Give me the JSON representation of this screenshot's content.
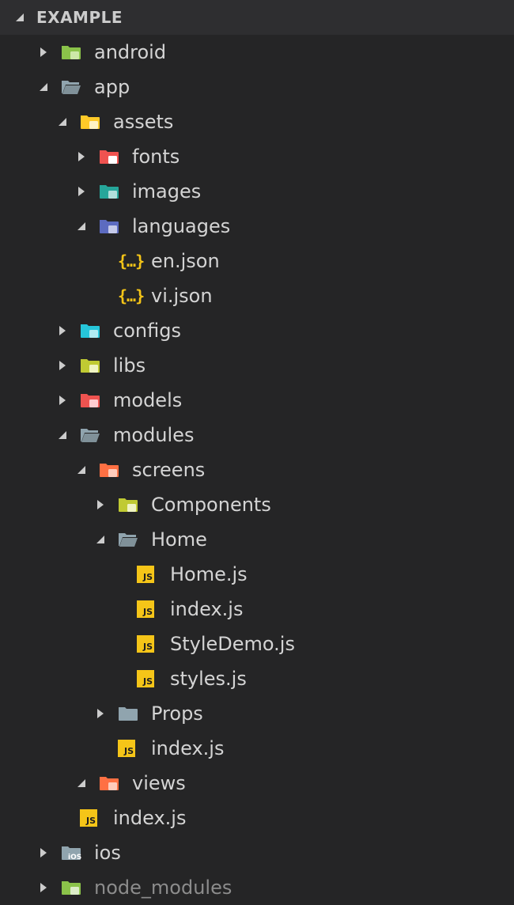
{
  "explorer": {
    "section_title": "EXAMPLE",
    "colors": {
      "background": "#252526",
      "header_background": "#2e2e30",
      "text": "#d4d4d4",
      "dim_text": "#8c8c8c",
      "js_badge": "#f5c518"
    }
  },
  "tree": [
    {
      "name": "android",
      "depth": 0,
      "kind": "folder",
      "expanded": false,
      "icon": "android-folder-icon",
      "color": "#8bc34a"
    },
    {
      "name": "app",
      "depth": 0,
      "kind": "folder",
      "expanded": true,
      "icon": "open-folder-icon",
      "color": "#90a4ae"
    },
    {
      "name": "assets",
      "depth": 1,
      "kind": "folder",
      "expanded": true,
      "icon": "assets-folder-icon",
      "color": "#ffca28"
    },
    {
      "name": "fonts",
      "depth": 2,
      "kind": "folder",
      "expanded": false,
      "icon": "fonts-folder-icon",
      "color": "#ef5350"
    },
    {
      "name": "images",
      "depth": 2,
      "kind": "folder",
      "expanded": false,
      "icon": "images-folder-icon",
      "color": "#26a69a"
    },
    {
      "name": "languages",
      "depth": 2,
      "kind": "folder",
      "expanded": true,
      "icon": "languages-folder-icon",
      "color": "#5c6bc0"
    },
    {
      "name": "en.json",
      "depth": 3,
      "kind": "json",
      "icon": "json-file-icon"
    },
    {
      "name": "vi.json",
      "depth": 3,
      "kind": "json",
      "icon": "json-file-icon"
    },
    {
      "name": "configs",
      "depth": 1,
      "kind": "folder",
      "expanded": false,
      "icon": "config-folder-icon",
      "color": "#26c6da"
    },
    {
      "name": "libs",
      "depth": 1,
      "kind": "folder",
      "expanded": false,
      "icon": "libs-folder-icon",
      "color": "#c0ca33"
    },
    {
      "name": "models",
      "depth": 1,
      "kind": "folder",
      "expanded": false,
      "icon": "models-folder-icon",
      "color": "#ef5350"
    },
    {
      "name": "modules",
      "depth": 1,
      "kind": "folder",
      "expanded": true,
      "icon": "open-folder-icon",
      "color": "#90a4ae"
    },
    {
      "name": "screens",
      "depth": 2,
      "kind": "folder",
      "expanded": true,
      "icon": "screens-folder-icon",
      "color": "#ff7043"
    },
    {
      "name": "Components",
      "depth": 3,
      "kind": "folder",
      "expanded": false,
      "icon": "components-folder-icon",
      "color": "#c0ca33"
    },
    {
      "name": "Home",
      "depth": 3,
      "kind": "folder",
      "expanded": true,
      "icon": "open-folder-icon",
      "color": "#90a4ae"
    },
    {
      "name": "Home.js",
      "depth": 4,
      "kind": "js",
      "icon": "js-file-icon"
    },
    {
      "name": "index.js",
      "depth": 4,
      "kind": "js",
      "icon": "js-file-icon"
    },
    {
      "name": "StyleDemo.js",
      "depth": 4,
      "kind": "js",
      "icon": "js-file-icon"
    },
    {
      "name": "styles.js",
      "depth": 4,
      "kind": "js",
      "icon": "js-file-icon"
    },
    {
      "name": "Props",
      "depth": 3,
      "kind": "folder",
      "expanded": false,
      "icon": "folder-icon",
      "color": "#90a4ae"
    },
    {
      "name": "index.js",
      "depth": 3,
      "kind": "js",
      "icon": "js-file-icon"
    },
    {
      "name": "views",
      "depth": 2,
      "kind": "folder",
      "expanded": true,
      "icon": "views-folder-icon",
      "color": "#ff7043"
    },
    {
      "name": "index.js",
      "depth": 1,
      "kind": "js",
      "icon": "js-file-icon"
    },
    {
      "name": "ios",
      "depth": 0,
      "kind": "folder",
      "expanded": false,
      "icon": "ios-folder-icon",
      "color": "#90a4ae"
    },
    {
      "name": "node_modules",
      "depth": 0,
      "kind": "folder",
      "expanded": false,
      "icon": "node-modules-folder-icon",
      "color": "#8bc34a",
      "dim": true
    }
  ]
}
